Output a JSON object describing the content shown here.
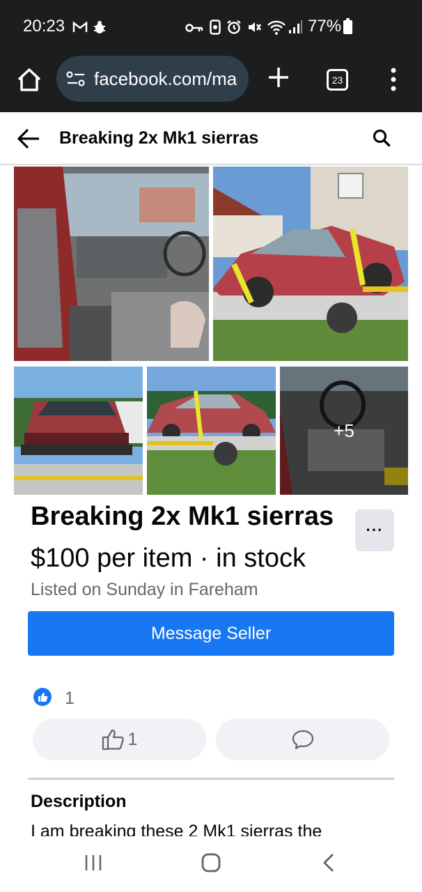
{
  "status_bar": {
    "time": "20:23",
    "battery": "77%",
    "left_icons": [
      "gmail-icon",
      "bug-icon"
    ],
    "right_icons": [
      "key-icon",
      "sim-icon",
      "alarm-icon",
      "mute-icon",
      "wifi-icon",
      "signal-icon",
      "battery-icon"
    ]
  },
  "browser": {
    "url": "facebook.com/ma",
    "tab_count": "23"
  },
  "header": {
    "title": "Breaking 2x Mk1 sierras"
  },
  "photos": {
    "more_count": "+5"
  },
  "listing": {
    "title": "Breaking 2x Mk1 sierras",
    "more_label": "···",
    "price": "$100 per item · in stock",
    "listed": "Listed on Sunday in Fareham",
    "message_button": "Message Seller"
  },
  "reactions": {
    "like_count": "1",
    "like_button_count": "1"
  },
  "description": {
    "heading": "Description",
    "text": "I am breaking these 2 Mk1 sierras the"
  },
  "colors": {
    "brand_blue": "#1877f2",
    "status_bg": "#1c1d1f",
    "url_pill": "#2e3f49"
  }
}
